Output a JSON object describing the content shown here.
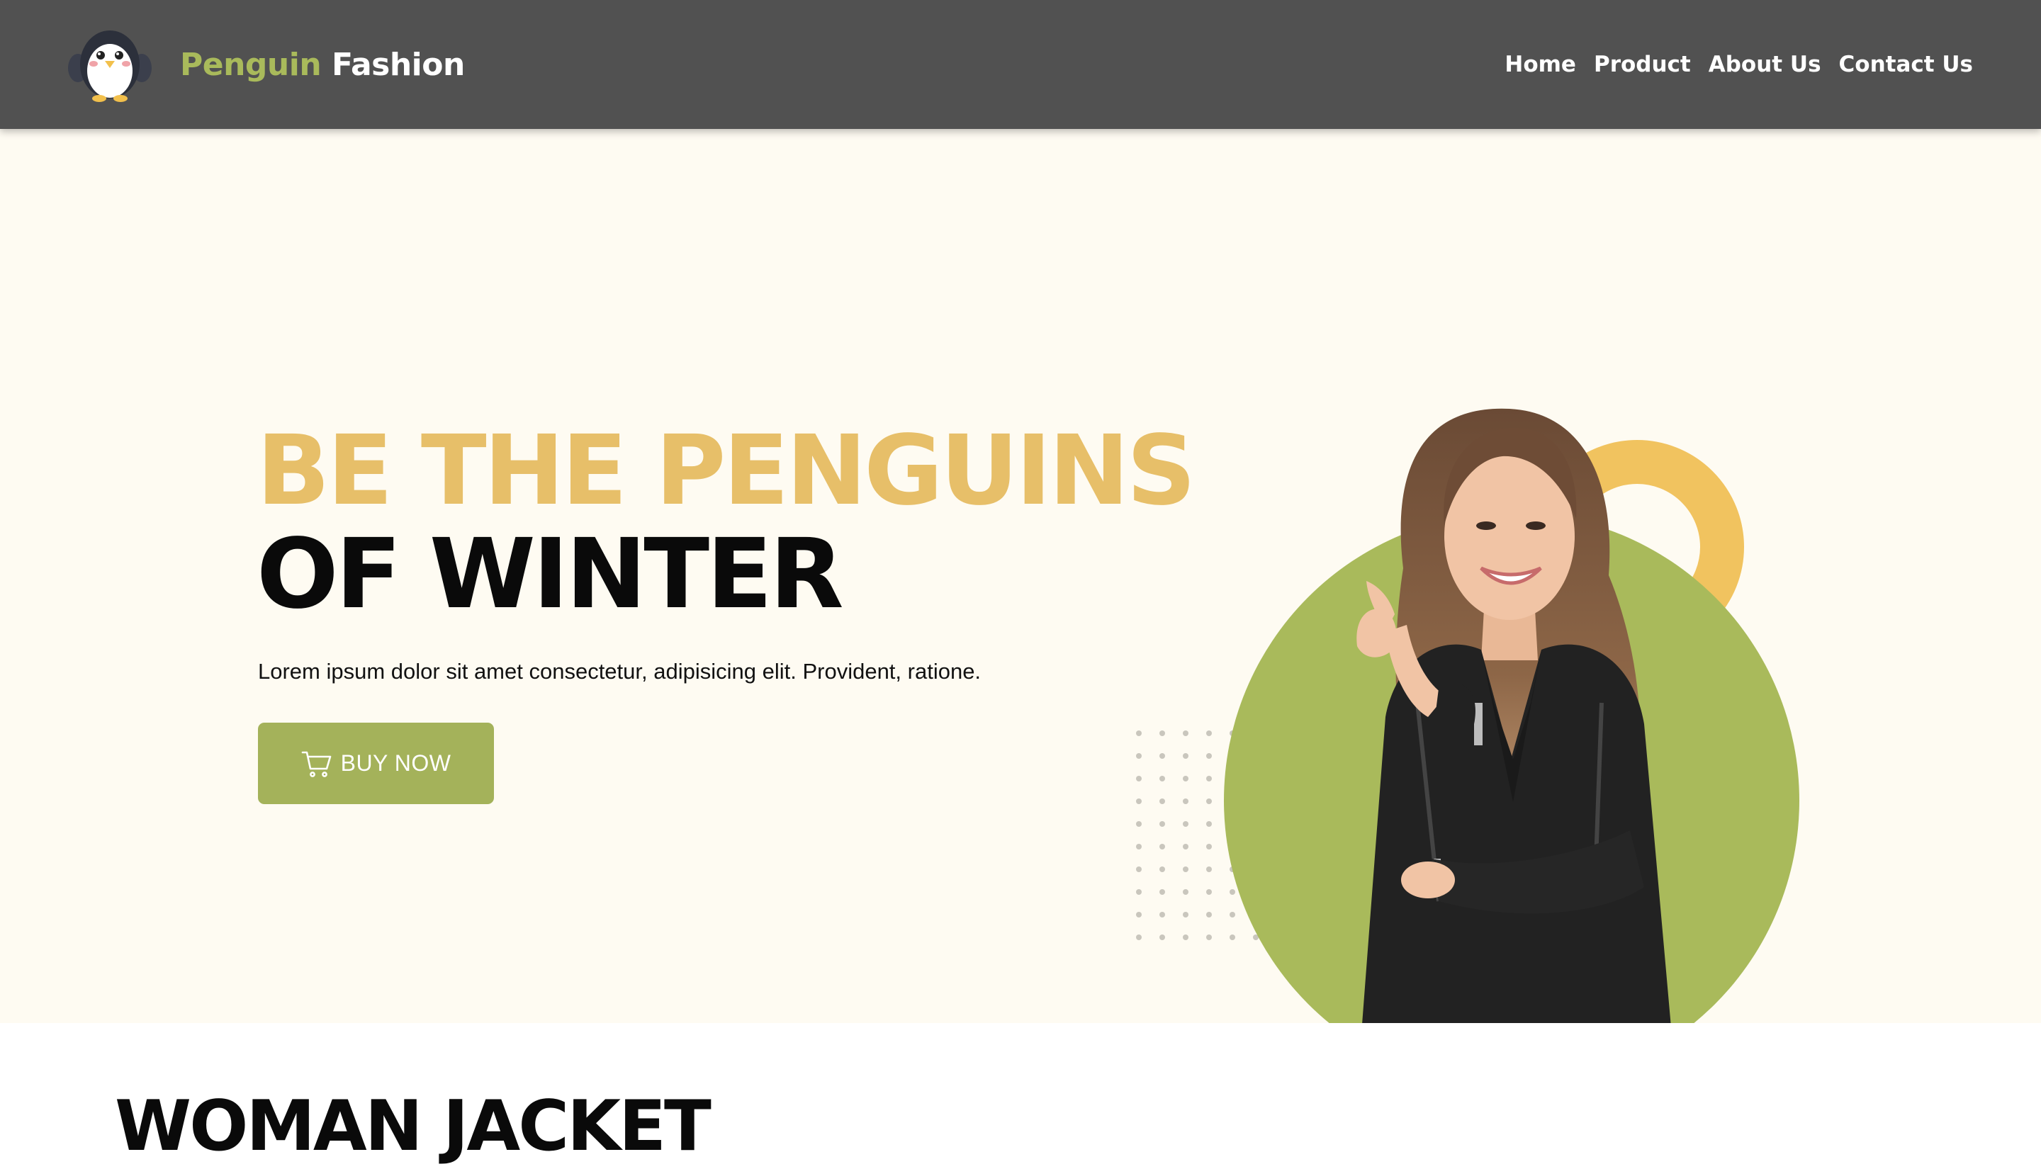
{
  "header": {
    "brand_part1": "Penguin",
    "brand_part2": "Fashion",
    "logo_icon": "penguin-logo-icon",
    "nav": [
      {
        "label": "Home"
      },
      {
        "label": "Product"
      },
      {
        "label": "About Us"
      },
      {
        "label": "Contact Us"
      }
    ]
  },
  "hero": {
    "headline_line1": "BE THE PENGUINS",
    "headline_line2": "OF WINTER",
    "description": "Lorem ipsum dolor sit amet consectetur, adipisicing elit. Provident, ratione.",
    "button": {
      "label": "BUY NOW",
      "icon": "cart-icon"
    },
    "image": "model-in-leather-jacket"
  },
  "section": {
    "title": "WOMAN JACKET"
  },
  "colors": {
    "navbar": "#515151",
    "brand_accent": "#a9ba5b",
    "hero_bg": "#fefbf2",
    "headline_accent": "#e7bf69",
    "button": "#a4b25a",
    "circle_green": "#a9ba5b",
    "ring_yellow": "#f1c35f"
  }
}
